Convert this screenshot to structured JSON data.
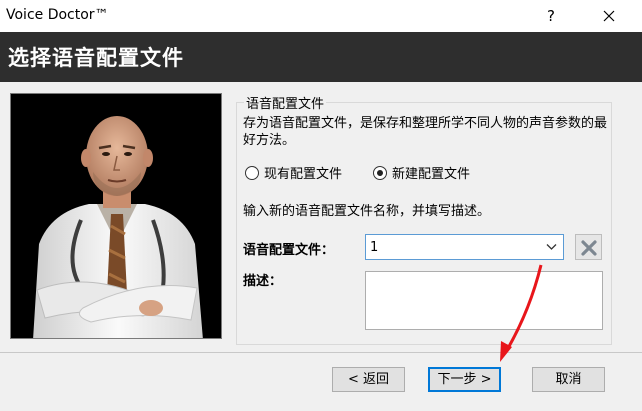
{
  "window": {
    "title": "Voice Doctor™",
    "help_glyph": "?"
  },
  "banner": {
    "heading": "选择语音配置文件"
  },
  "group": {
    "legend": "语音配置文件",
    "description": "存为语音配置文件，是保存和整理所学不同人物的声音参数的最好方法。",
    "radio_existing": "现有配置文件",
    "radio_new": "新建配置文件",
    "selected_radio": "new",
    "instruction": "输入新的语音配置文件名称，并填写描述。",
    "profile_label": "语音配置文件：",
    "profile_value": "1",
    "desc_label": "描述：",
    "desc_value": ""
  },
  "buttons": {
    "back": "< 返回",
    "next": "下一步 >",
    "cancel": "取消"
  },
  "colors": {
    "banner_bg": "#2e2e2e",
    "combo_border": "#5b9bd5",
    "annotation_arrow": "#e8161b"
  }
}
